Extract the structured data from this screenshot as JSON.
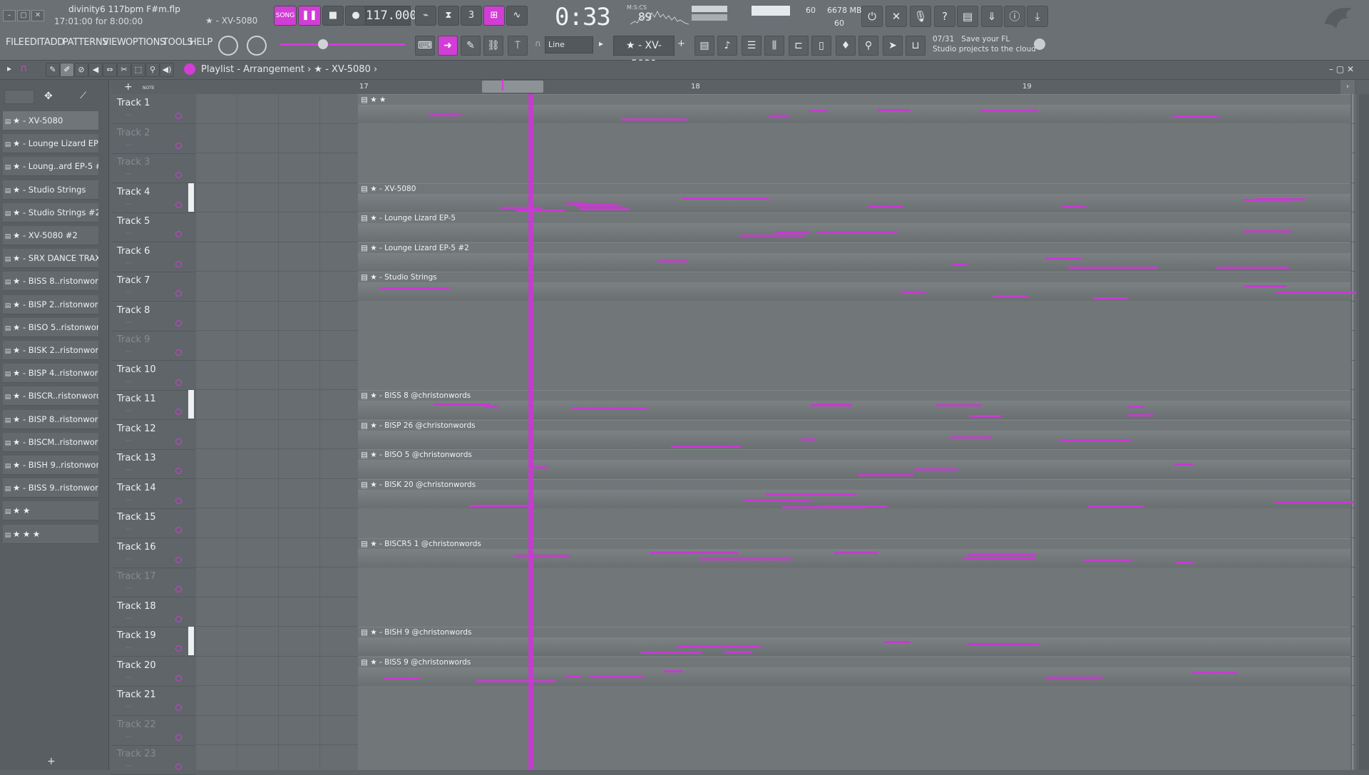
{
  "window": {
    "title": "divinity6 117bpm F#m.flp",
    "time_info": "17:01:00 for 8:00:00",
    "hint_channel": "★ - XV-5080",
    "controls": [
      "–",
      "▢",
      "✕"
    ]
  },
  "transport": {
    "song_label": "SONG",
    "tempo": "117.000",
    "time": "0:33",
    "time_ms": "89",
    "time_label": "M:S:CS",
    "cpu": "60",
    "memory": "6678 MB",
    "polyphony": "60"
  },
  "menu": [
    "FILE",
    "EDIT",
    "ADD",
    "PATTERNS",
    "VIEW",
    "OPTIONS",
    "TOOLS",
    "HELP"
  ],
  "toolbar": {
    "snap": "Line",
    "pattern": "★ - XV-5080",
    "news_counter": "07/31",
    "news_line1": "Save your FL",
    "news_line2": "Studio projects to the cloud"
  },
  "playlist": {
    "breadcrumb": "Playlist - Arrangement › ★ - XV-5080 ›",
    "ruler": [
      "17",
      "18",
      "19"
    ]
  },
  "picker": [
    "★ - XV-5080",
    "★ - Lounge Lizard EP-5",
    "★ - Loung..ard EP-5 #2",
    "★ - Studio Strings",
    "★ - Studio Strings #2",
    "★ - XV-5080 #2",
    "★ - SRX DANCE TRAX",
    "★ - BISS 8..ristonwords",
    "★ - BISP 2..ristonwords",
    "★ - BISO 5..ristonwords",
    "★ - BISK 2..ristonwords",
    "★ - BISP 4..ristonwords",
    "★ - BISCR..ristonwords",
    "★ - BISP 8..ristonwords",
    "★ - BISCM..ristonwords",
    "★ - BISH 9..ristonwords",
    "★ - BISS 9..ristonwords",
    "★ ★",
    "★ ★ ★"
  ],
  "tracks": [
    {
      "name": "Track 1",
      "dim": false
    },
    {
      "name": "Track 2",
      "dim": true
    },
    {
      "name": "Track 3",
      "dim": true
    },
    {
      "name": "Track 4",
      "dim": false
    },
    {
      "name": "Track 5",
      "dim": false
    },
    {
      "name": "Track 6",
      "dim": false
    },
    {
      "name": "Track 7",
      "dim": false
    },
    {
      "name": "Track 8",
      "dim": false
    },
    {
      "name": "Track 9",
      "dim": true
    },
    {
      "name": "Track 10",
      "dim": false
    },
    {
      "name": "Track 11",
      "dim": false
    },
    {
      "name": "Track 12",
      "dim": false
    },
    {
      "name": "Track 13",
      "dim": false
    },
    {
      "name": "Track 14",
      "dim": false
    },
    {
      "name": "Track 15",
      "dim": false
    },
    {
      "name": "Track 16",
      "dim": false
    },
    {
      "name": "Track 17",
      "dim": true
    },
    {
      "name": "Track 18",
      "dim": false
    },
    {
      "name": "Track 19",
      "dim": false
    },
    {
      "name": "Track 20",
      "dim": false
    },
    {
      "name": "Track 21",
      "dim": false
    },
    {
      "name": "Track 22",
      "dim": true
    },
    {
      "name": "Track 23",
      "dim": true
    }
  ],
  "clips": [
    {
      "track": 1,
      "rows": 3,
      "title": "★ ★"
    },
    {
      "track": 4,
      "rows": 1,
      "title": "★ - XV-5080"
    },
    {
      "track": 5,
      "rows": 1,
      "title": "★ - Lounge Lizard EP-5"
    },
    {
      "track": 6,
      "rows": 1,
      "title": "★ - Lounge Lizard EP-5 #2"
    },
    {
      "track": 7,
      "rows": 4,
      "title": "★ - Studio Strings"
    },
    {
      "track": 11,
      "rows": 1,
      "title": "★ - BISS 8 @christonwords"
    },
    {
      "track": 12,
      "rows": 1,
      "title": "★ - BISP 26 @christonwords"
    },
    {
      "track": 13,
      "rows": 1,
      "title": "★ - BISO 5 @christonwords"
    },
    {
      "track": 14,
      "rows": 2,
      "title": "★ - BISK 20 @christonwords"
    },
    {
      "track": 16,
      "rows": 3,
      "title": "★ - BISCR5 1 @christonwords"
    },
    {
      "track": 19,
      "rows": 1,
      "title": "★ - BISH 9 @christonwords"
    },
    {
      "track": 20,
      "rows": 4,
      "title": "★ - BISS 9 @christonwords"
    }
  ],
  "colors": {
    "accent": "#d23dd6",
    "note": "#c73bd0",
    "bg": "#676d71"
  }
}
